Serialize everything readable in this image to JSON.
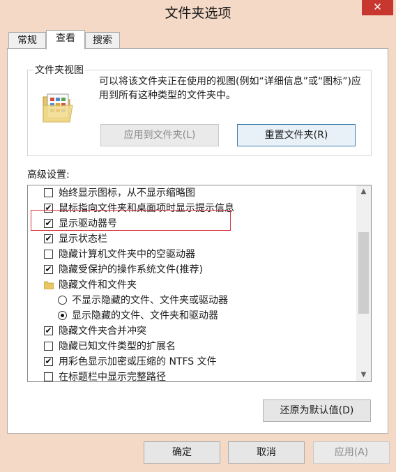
{
  "window": {
    "title": "文件夹选项",
    "close_glyph": "✕"
  },
  "tabs": [
    {
      "label": "常规",
      "active": false
    },
    {
      "label": "查看",
      "active": true
    },
    {
      "label": "搜索",
      "active": false
    }
  ],
  "folder_views": {
    "title": "文件夹视图",
    "description": "可以将该文件夹正在使用的视图(例如“详细信息”或“图标”)应用到所有这种类型的文件夹中。",
    "apply_button": "应用到文件夹(L)",
    "reset_button": "重置文件夹(R)",
    "icon": "folder-view-icon"
  },
  "advanced": {
    "label": "高级设置:",
    "items": [
      {
        "type": "checkbox",
        "checked": false,
        "label": "始终显示图标，从不显示缩略图"
      },
      {
        "type": "checkbox",
        "checked": true,
        "label": "鼠标指向文件夹和桌面项时显示提示信息"
      },
      {
        "type": "checkbox",
        "checked": true,
        "label": "显示驱动器号"
      },
      {
        "type": "checkbox",
        "checked": true,
        "label": "显示状态栏"
      },
      {
        "type": "checkbox",
        "checked": false,
        "label": "隐藏计算机文件夹中的空驱动器"
      },
      {
        "type": "checkbox",
        "checked": true,
        "label": "隐藏受保护的操作系统文件(推荐)"
      },
      {
        "type": "folder",
        "label": "隐藏文件和文件夹"
      },
      {
        "type": "radio",
        "checked": false,
        "label": "不显示隐藏的文件、文件夹或驱动器"
      },
      {
        "type": "radio",
        "checked": true,
        "label": "显示隐藏的文件、文件夹和驱动器"
      },
      {
        "type": "checkbox",
        "checked": true,
        "label": "隐藏文件夹合并冲突"
      },
      {
        "type": "checkbox",
        "checked": false,
        "label": "隐藏已知文件类型的扩展名"
      },
      {
        "type": "checkbox",
        "checked": true,
        "label": "用彩色显示加密或压缩的 NTFS 文件"
      },
      {
        "type": "checkbox",
        "checked": false,
        "label": "在标题栏中显示完整路径"
      }
    ],
    "restore_button": "还原为默认值(D)"
  },
  "footer": {
    "ok": "确定",
    "cancel": "取消",
    "apply": "应用(A)"
  },
  "colors": {
    "titlebar": "#f4d9c6",
    "close": "#c7372f",
    "highlight": "#d9333d",
    "focus": "#3c7fb1"
  }
}
